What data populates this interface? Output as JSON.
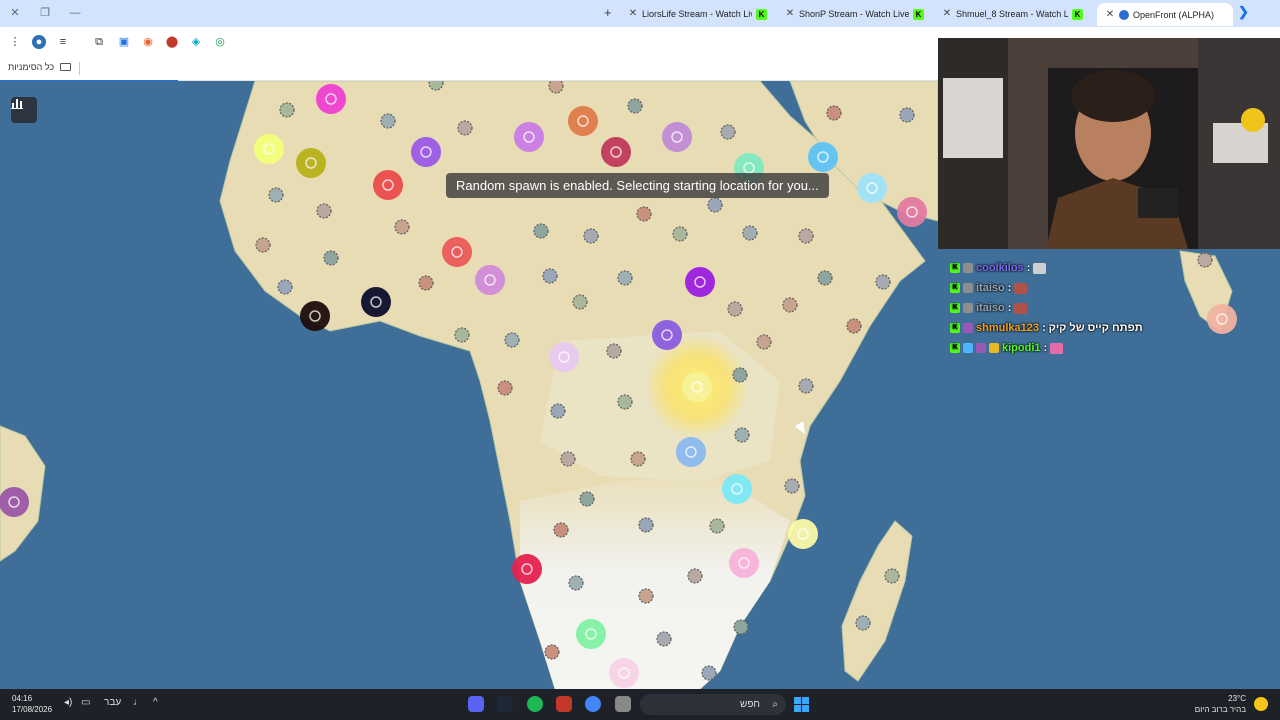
{
  "window_controls": {
    "close": "✕",
    "restore": "❐",
    "minimize": "—"
  },
  "tabs": [
    {
      "title": "LiorsLife Stream - Watch Live on",
      "close": "✕",
      "badge": "K"
    },
    {
      "title": "ShonP Stream - Watch Live on",
      "close": "✕",
      "badge": "K"
    },
    {
      "title": "Shmuel_8 Stream - Watch Live",
      "close": "✕",
      "badge": "K"
    },
    {
      "title": "OpenFront (ALPHA)",
      "close": "✕",
      "active": true
    }
  ],
  "new_tab": "+",
  "tab_scroll": "❯",
  "bookmarks_bar": {
    "all_bookmarks": "כל הסימניות"
  },
  "game": {
    "toast": "Random spawn is enabled. Selecting starting location for you...",
    "stats_icon": "bar-chart-icon"
  },
  "chat": [
    {
      "user": "coolkilos",
      "sep": ":",
      "message": "",
      "user_color": "#7b68ee",
      "emote_color": "#cfcfcf",
      "badges": [
        "kick",
        "sword"
      ]
    },
    {
      "user": "itaiso",
      "sep": ":",
      "message": "",
      "user_color": "#9aa5b1",
      "emote_color": "#b0524a",
      "badges": [
        "kick",
        "sword"
      ]
    },
    {
      "user": "itaiso",
      "sep": ":",
      "message": "",
      "user_color": "#9aa5b1",
      "emote_color": "#b0524a",
      "badges": [
        "kick",
        "sword"
      ]
    },
    {
      "user": "shmulka123",
      "sep": ":",
      "message": "תפתח קייס של קיק",
      "user_color": "#f0a020",
      "emote_color": "",
      "badges": [
        "kick",
        "purple"
      ]
    },
    {
      "user": "kipodi1",
      "sep": ":",
      "message": "",
      "user_color": "#53fc18",
      "emote_color": "#e46ca8",
      "badges": [
        "kick",
        "blue",
        "purple",
        "gold"
      ]
    }
  ],
  "taskbar": {
    "time": "04:16",
    "date": "17/08/2026",
    "language": "עבר",
    "search_placeholder": "חפש",
    "search_icon": "⌕",
    "chevron": "^",
    "temperature": "23°C",
    "weather": "בהיר ברוב היום"
  },
  "colors": {
    "ocean": "#3f6e98",
    "land": "#e8dcb5",
    "accent": "#1a73e8",
    "kick_green": "#53fc18"
  }
}
